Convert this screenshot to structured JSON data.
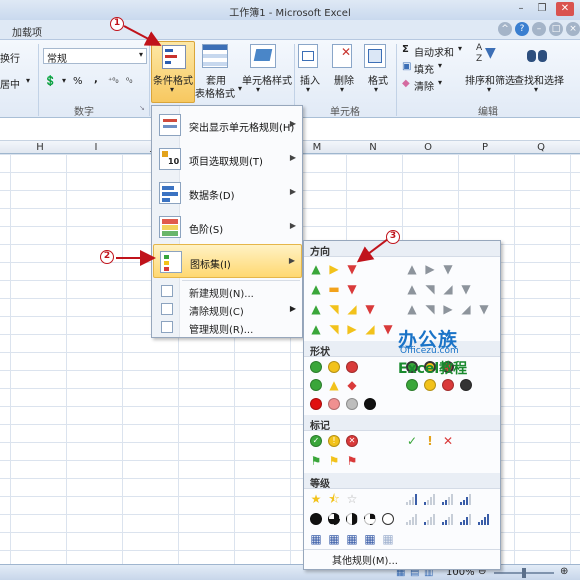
{
  "window": {
    "title": "工作簿1 - Microsoft Excel"
  },
  "tabs": {
    "addins": "加载项"
  },
  "ribbon": {
    "wrap_text": "换行",
    "merge_center": "居中",
    "number_format": "常规",
    "percent": "%",
    "comma": ",",
    "group_number": "数字",
    "conditional_format": "条件格式",
    "table_format_1": "套用",
    "table_format_2": "表格格式",
    "cell_styles": "单元格样式",
    "insert": "插入",
    "delete": "删除",
    "format": "格式",
    "group_cells": "单元格",
    "autosum": "自动求和",
    "fill": "填充",
    "clear": "清除",
    "sort_filter": "排序和筛选",
    "find_select": "查找和选择",
    "group_edit": "编辑"
  },
  "columns": [
    "H",
    "I",
    "J",
    "M",
    "N",
    "O",
    "P",
    "Q"
  ],
  "menu": {
    "highlight_rules": "突出显示单元格规则(H)",
    "top_bottom": "项目选取规则(T)",
    "data_bars": "数据条(D)",
    "color_scales": "色阶(S)",
    "icon_sets": "图标集(I)",
    "new_rule": "新建规则(N)...",
    "clear_rules": "清除规则(C)",
    "manage_rules": "管理规则(R)..."
  },
  "submenu": {
    "sec_direction": "方向",
    "sec_shapes": "形状",
    "sec_indicators": "标记",
    "sec_ratings": "等级",
    "more_rules": "其他规则(M)..."
  },
  "annotations": {
    "one": "1",
    "two": "2",
    "three": "3"
  },
  "watermark": {
    "brand": "办公族",
    "site": "Officezu.com",
    "course": "Excel教程"
  },
  "status": {
    "zoom": "100%"
  },
  "colors": {
    "accent": "#c0131b",
    "green": "#3aa63a",
    "yellow": "#f2c21b",
    "red": "#d93a3a",
    "gray": "#9aa3ad"
  }
}
